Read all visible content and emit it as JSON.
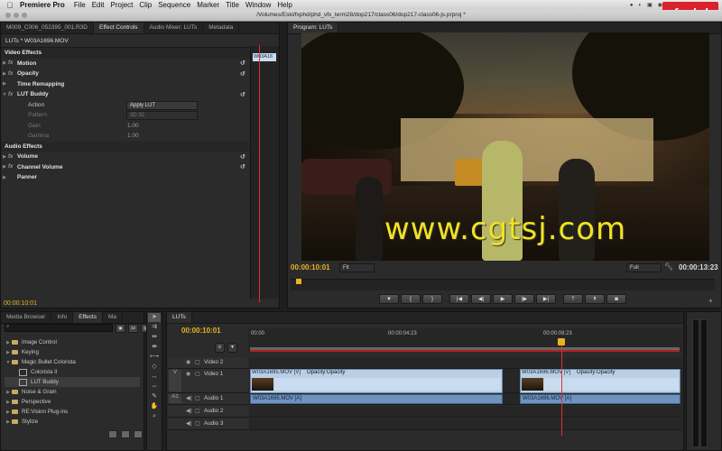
{
  "menubar": {
    "app": "Premiere Pro",
    "items": [
      "File",
      "Edit",
      "Project",
      "Clip",
      "Sequence",
      "Marker",
      "Title",
      "Window",
      "Help"
    ]
  },
  "logo": {
    "text": "fxphd"
  },
  "window": {
    "title": "/Volumes/Eski/fxphd/phd_vfx_term28/dop217/class06/dop217-class06-js.prproj *"
  },
  "effect_controls": {
    "tabs": [
      "M009_C006_052395_001.R3D",
      "Effect Controls",
      "Audio Mixer: LUTs",
      "Metadata"
    ],
    "header": "LUTs * W03A1696.MOV",
    "clip_label": "W03A16",
    "timecode": "00:00:10:01",
    "rows": [
      {
        "label": "Video Effects",
        "type": "section"
      },
      {
        "label": "Motion",
        "type": "bold",
        "fx": true,
        "reset": true
      },
      {
        "label": "Opacity",
        "type": "bold",
        "fx": true,
        "reset": true
      },
      {
        "label": "Time Remapping",
        "type": "bold"
      },
      {
        "label": "LUT Buddy",
        "type": "bold",
        "fx": true,
        "open": true,
        "reset": true
      },
      {
        "label": "Action",
        "type": "param",
        "dropdown": "Apply LUT"
      },
      {
        "label": "Pattern",
        "type": "param-dim",
        "dropdown": "3D 32"
      },
      {
        "label": "Gain",
        "type": "param-dim",
        "value": "1.00"
      },
      {
        "label": "Gamma",
        "type": "param-dim",
        "value": "1.00"
      },
      {
        "label": "Audio Effects",
        "type": "section"
      },
      {
        "label": "Volume",
        "type": "bold",
        "fx": true,
        "reset": true
      },
      {
        "label": "Channel Volume",
        "type": "bold",
        "fx": true,
        "reset": true
      },
      {
        "label": "Panner",
        "type": "bold"
      }
    ]
  },
  "program": {
    "tab": "Program: LUTs",
    "timecode_left": "00:00:10:01",
    "fit": "Fit",
    "full": "Full",
    "timecode_right": "00:00:13:23",
    "watermark": "www.cgtsj.com"
  },
  "effects_panel": {
    "tabs": [
      "Media Browser",
      "Info",
      "Effects",
      "Ma"
    ],
    "search_placeholder": "",
    "tree": [
      {
        "label": "Image Control",
        "kind": "folder",
        "open": false
      },
      {
        "label": "Keying",
        "kind": "folder",
        "open": false
      },
      {
        "label": "Magic Bullet Colorista",
        "kind": "folder",
        "open": true
      },
      {
        "label": "Colorista II",
        "kind": "fx",
        "indent": true
      },
      {
        "label": "LUT Buddy",
        "kind": "fx",
        "indent": true,
        "selected": true
      },
      {
        "label": "Noise & Grain",
        "kind": "folder",
        "open": false
      },
      {
        "label": "Perspective",
        "kind": "folder",
        "open": false
      },
      {
        "label": "RE:Vision Plug-ins",
        "kind": "folder",
        "open": false
      },
      {
        "label": "Stylize",
        "kind": "folder",
        "open": false
      }
    ]
  },
  "timeline": {
    "tab": "LUTs",
    "timecode": "00:00:10:01",
    "ruler": [
      "00:00",
      "00:00:04:23",
      "00:00:09:23"
    ],
    "tracks": {
      "v2": "Video 2",
      "v1": "Video 1",
      "a1": "Audio 1",
      "a2": "Audio 2",
      "a3": "Audio 3",
      "src_v": "V",
      "src_a": "A1"
    },
    "clips": {
      "v1_a_name": "W03A1695.MOV [V]",
      "v1_a_op": "Opacity:Opacity",
      "v1_b_name": "W03A1696.MOV [V]",
      "v1_b_op": "Opacity:Opacity",
      "a1_a_name": "W03A1695.MOV [A]",
      "a1_b_name": "W03A1696.MOV [A]"
    }
  },
  "colors": {
    "accent_timecode": "#e6b422",
    "playhead": "#dd3333",
    "video_clip": "#b9cfe6",
    "audio_clip": "#6f93bd"
  }
}
